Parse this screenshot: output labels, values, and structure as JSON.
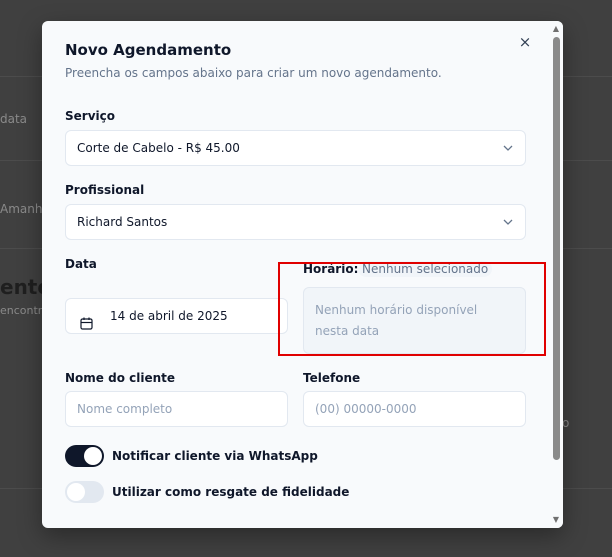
{
  "background": {
    "snippets": [
      "data",
      "Amanhã",
      "entos",
      "encontr",
      "o"
    ]
  },
  "modal": {
    "title": "Novo Agendamento",
    "description": "Preencha os campos abaixo para criar um novo agendamento.",
    "close_label": "×"
  },
  "form": {
    "service": {
      "label": "Serviço",
      "value": "Corte de Cabelo - R$ 45.00"
    },
    "professional": {
      "label": "Profissional",
      "value": "Richard Santos"
    },
    "date": {
      "label": "Data",
      "value": "14 de abril de 2025"
    },
    "time": {
      "label": "Horário:",
      "badge": "Nenhum selecionado",
      "empty_message": "Nenhum horário disponível nesta data"
    },
    "client_name": {
      "label": "Nome do cliente",
      "placeholder": "Nome completo"
    },
    "phone": {
      "label": "Telefone",
      "placeholder": "(00) 00000-0000"
    },
    "notify_whatsapp": {
      "label": "Notificar cliente via WhatsApp",
      "enabled": true
    },
    "loyalty_redeem": {
      "label": "Utilizar como resgate de fidelidade",
      "enabled": false
    }
  },
  "icons": {
    "chevron": "chevron-down-icon",
    "calendar": "calendar-icon",
    "close": "close-icon"
  },
  "colors": {
    "primary": "#0f172a",
    "muted": "#64748b",
    "highlight": "#e00000"
  }
}
